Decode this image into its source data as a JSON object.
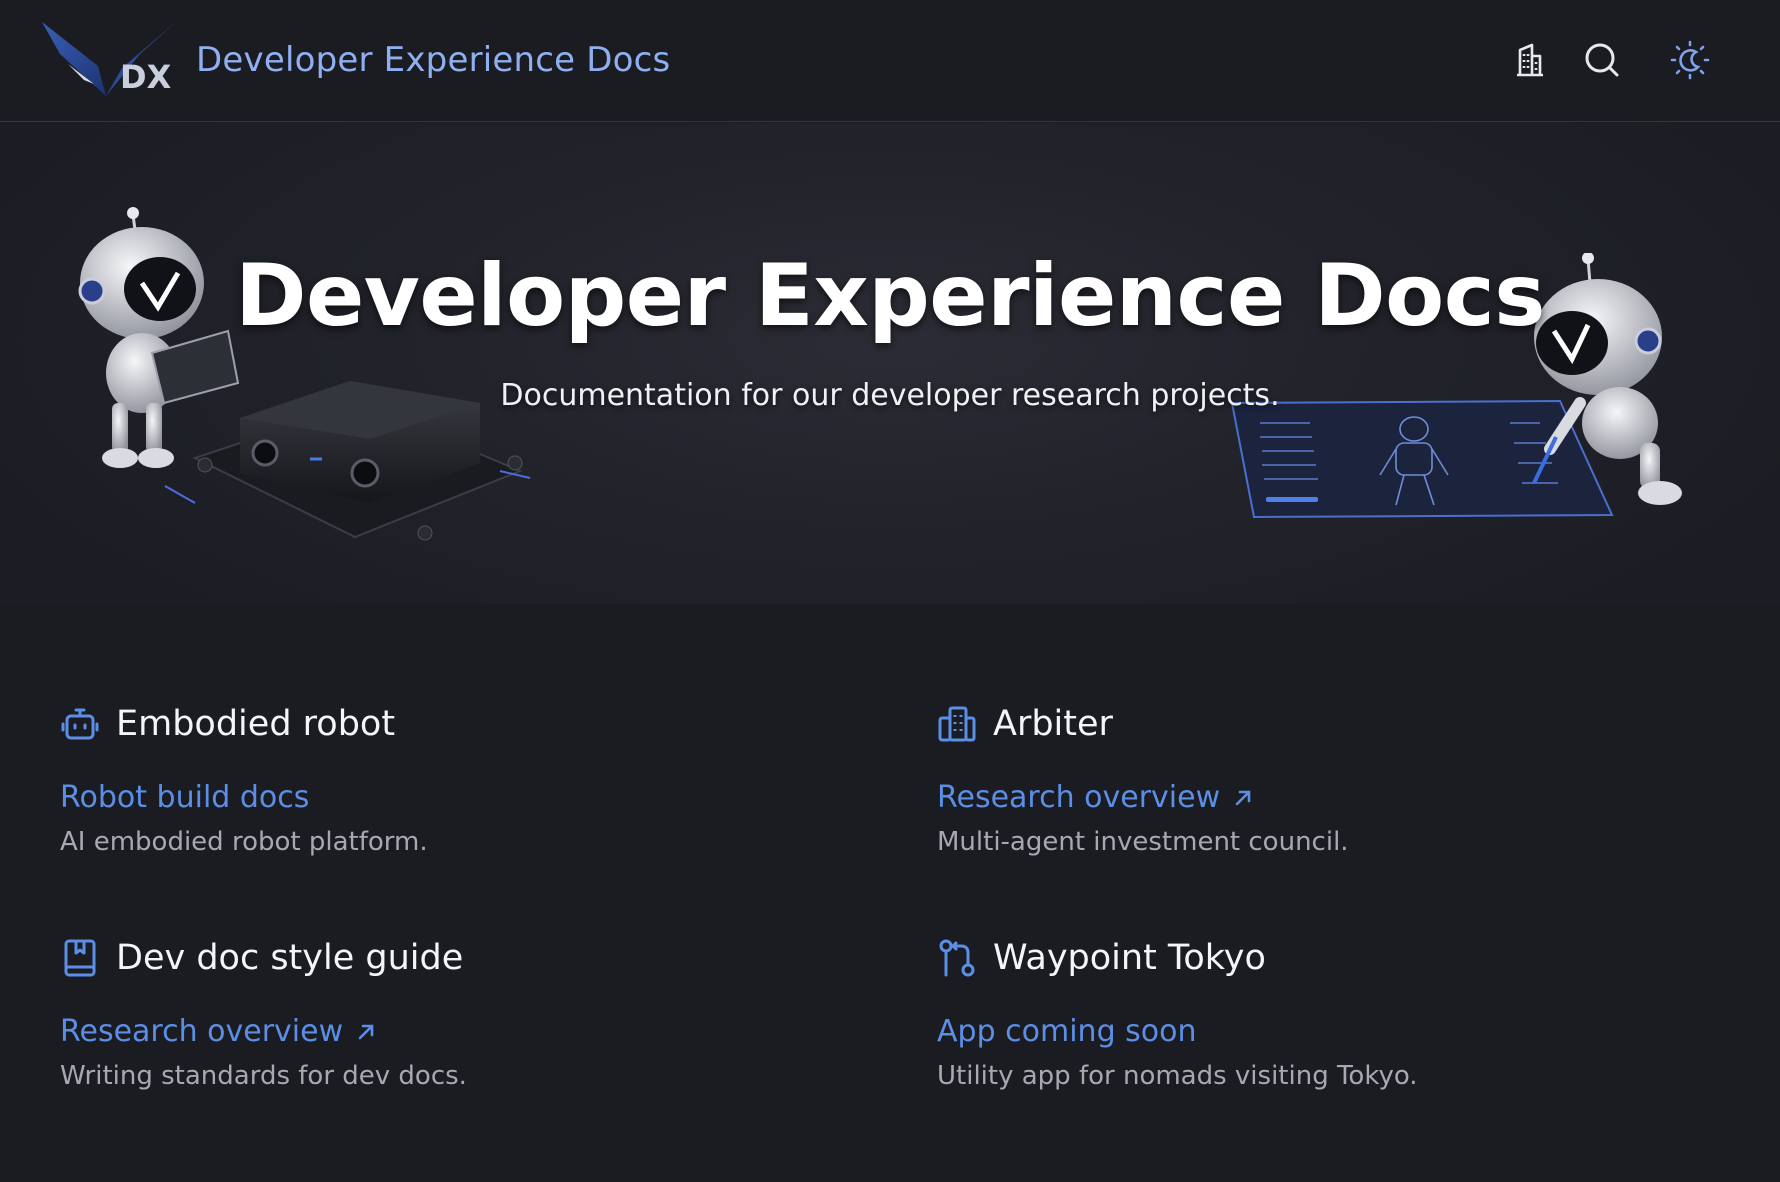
{
  "header": {
    "logo_text": "DX",
    "site_title": "Developer Experience Docs",
    "icons": [
      "building-icon",
      "search-icon",
      "theme-toggle-icon"
    ]
  },
  "hero": {
    "title": "Developer Experience Docs",
    "subtitle": "Documentation for our developer research projects."
  },
  "colors": {
    "background": "#1b1c22",
    "accent": "#5b8fe6",
    "site_title": "#8fb0f0",
    "muted_text": "#a7a9b1"
  },
  "cards": [
    {
      "icon": "robot-icon",
      "title": "Embodied robot",
      "link": "Robot build docs",
      "external": false,
      "description": "AI embodied robot platform."
    },
    {
      "icon": "building-icon",
      "title": "Arbiter",
      "link": "Research overview",
      "external": true,
      "description": "Multi-agent investment council."
    },
    {
      "icon": "book-icon",
      "title": "Dev doc style guide",
      "link": "Research overview",
      "external": true,
      "description": "Writing standards for dev docs."
    },
    {
      "icon": "route-icon",
      "title": "Waypoint Tokyo",
      "link": "App coming soon",
      "external": false,
      "description": "Utility app for nomads visiting Tokyo."
    }
  ]
}
